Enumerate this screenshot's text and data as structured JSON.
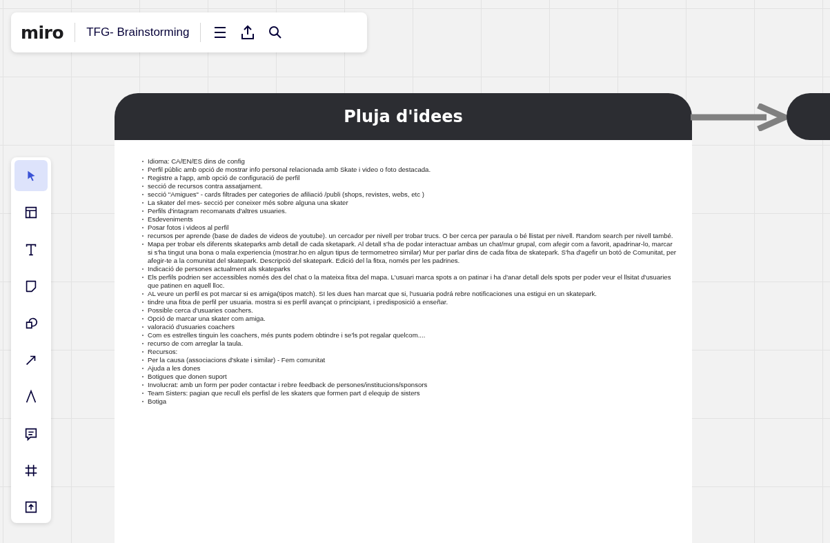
{
  "topbar": {
    "logo": "miro",
    "board_title": "TFG- Brainstorming"
  },
  "tools": [
    {
      "kind": "select",
      "selected": true
    },
    {
      "kind": "template",
      "selected": false
    },
    {
      "kind": "text",
      "selected": false
    },
    {
      "kind": "sticky",
      "selected": false
    },
    {
      "kind": "shapes",
      "selected": false
    },
    {
      "kind": "line",
      "selected": false
    },
    {
      "kind": "pen",
      "selected": false
    },
    {
      "kind": "comment",
      "selected": false
    },
    {
      "kind": "frame",
      "selected": false
    },
    {
      "kind": "upload",
      "selected": false
    }
  ],
  "board": {
    "header": "Pluja d'idees",
    "items": [
      "Idioma: CA/EN/ES dins de config",
      "Perfil públic amb opció de mostrar info personal relacionada amb Skate i video o foto destacada.",
      "Registre a l'app, amb opció de configuració de perfil",
      "secció de recursos contra assatjament.",
      "secció \"Amigues\" - cards filtrades per categories de afiliació /publi (shops, revistes, webs, etc )",
      "La skater del mes- secció per coneixer més sobre alguna una skater",
      "Perfils d'intagram recomanats d'altres usuaries.",
      "Esdeveniments",
      "Posar fotos i videos al perfil",
      "recursos per aprende (base de dades de videos de youtube). un cercador per nivell per trobar trucs. O ber cerca per paraula o bé llistat per nivell. Random search per nivell també.",
      "Mapa per trobar els diferents skateparks amb detall de cada sketapark. Al detall s'ha de podar interactuar ambas un chat/mur grupal, com afegir com a favorit, apadrinar-lo, marcar si s'ha tingut una bona o mala experiencia (mostrar.ho en algun tipus de termometreo similar) Mur per parlar dins de cada fitxa de skatepark. S'ha d'agefir un botó de Comunitat, per afegir-te a la comunitat del skatepark. Descripció del skatepark. Edició del la fitxa, només per les padrines.",
      "Indicació de persones actualment als skateparks",
      "Els perfils podrien ser accessibles només des del chat o la mateixa fitxa del mapa. L'usuari marca spots a on patinar i ha d'anar detall dels spots per poder veur el llsitat d'usuaries que patinen en aquell lloc.",
      "AL veure un perfil es pot marcar si es amiga(tipos match). SI les dues han marcat que si, l'usuaria podrá rebre notificaciones una estigui en un skatepark.",
      "tindre una fitxa de perfil per usuaria. mostra si es perfil avançat o principiant, i predisposició a enseñar.",
      "Possible cerca d'usuaries coachers.",
      "Opció de marcar una skater com amiga.",
      "valoració d'usuaries coachers",
      "Com es estrelles tinguin les coachers, més punts podem obtindre i se'ls pot regalar quelcom....",
      "recurso de com arreglar la taula.",
      "Recursos:",
      "Per la causa (associacions d'skate i similar) - Fem comunitat",
      "Ajuda a les dones",
      "Botigues que donen suport",
      "Involucrat: amb un form per poder contactar i rebre feedback de persones/institucions/sponsors",
      "Team Sisters: pagian que recull els perfisl de les skaters que formen part d elequip de sisters",
      "Botiga"
    ]
  }
}
